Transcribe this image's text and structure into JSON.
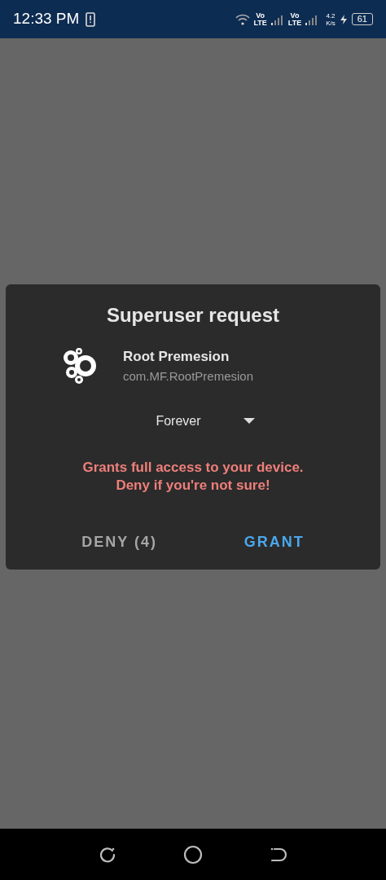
{
  "status_bar": {
    "time": "12:33 PM",
    "network_1": [
      "Vo",
      "LTE"
    ],
    "network_2": [
      "Vo",
      "LTE"
    ],
    "speed": [
      "4.2",
      "K/s"
    ],
    "battery": "61"
  },
  "dialog": {
    "title": "Superuser request",
    "app_name": "Root Premesion",
    "package": "com.MF.RootPremesion",
    "duration": "Forever",
    "warning": [
      "Grants full access to your device.",
      "Deny if you're not sure!"
    ],
    "buttons": [
      {
        "kind": "deny",
        "label": "DENY (4)"
      },
      {
        "kind": "grant",
        "label": "GRANT"
      }
    ]
  }
}
